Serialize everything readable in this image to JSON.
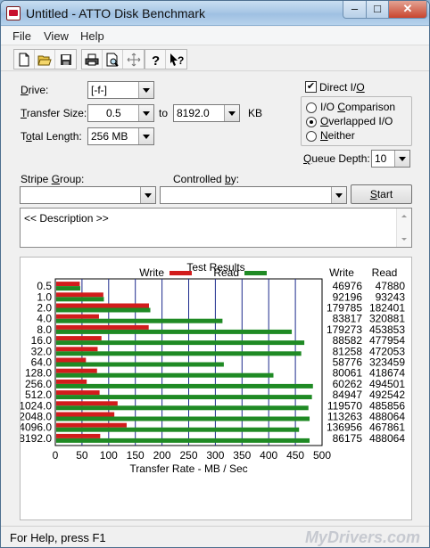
{
  "window": {
    "title": "Untitled - ATTO Disk Benchmark"
  },
  "caption": {
    "minimize": "–",
    "maximize": "□",
    "close": "✕"
  },
  "menu": [
    "File",
    "View",
    "Help"
  ],
  "toolbar": {
    "icons": [
      "new-icon",
      "open-icon",
      "save-icon",
      "print-icon",
      "print-preview-icon",
      "move-icon",
      "help-icon",
      "context-help-icon"
    ]
  },
  "form": {
    "drive_label": "Drive:",
    "drive_value": "[-f-]",
    "transfer_label": "Transfer Size:",
    "transfer_from": "0.5",
    "transfer_to_label": "to",
    "transfer_to": "8192.0",
    "transfer_unit": "KB",
    "length_label": "Total Length:",
    "length_value": "256 MB",
    "direct_io_label": "Direct I/O",
    "direct_io_checked": true,
    "io_options": [
      {
        "label": "I/O Comparison",
        "selected": false
      },
      {
        "label": "Overlapped I/O",
        "selected": true
      },
      {
        "label": "Neither",
        "selected": false
      }
    ],
    "queue_label": "Queue Depth:",
    "queue_value": "10",
    "stripe_label": "Stripe Group:",
    "stripe_value": "",
    "controlled_label": "Controlled by:",
    "controlled_value": "",
    "start_label": "Start",
    "description": "<< Description >>"
  },
  "results": {
    "title": "Test Results",
    "write_legend": "Write",
    "read_legend": "Read",
    "col_write": "Write",
    "col_read": "Read"
  },
  "chart_data": {
    "type": "bar",
    "categories": [
      "0.5",
      "1.0",
      "2.0",
      "4.0",
      "8.0",
      "16.0",
      "32.0",
      "64.0",
      "128.0",
      "256.0",
      "512.0",
      "1024.0",
      "2048.0",
      "4096.0",
      "8192.0"
    ],
    "series": [
      {
        "name": "Write",
        "color": "#d21c1c",
        "values": [
          46976,
          92196,
          179785,
          83817,
          179273,
          88582,
          81258,
          58776,
          80061,
          60262,
          84947,
          119570,
          113263,
          136956,
          86175
        ]
      },
      {
        "name": "Read",
        "color": "#1f8a24",
        "values": [
          47880,
          93243,
          182401,
          320881,
          453853,
          477954,
          472053,
          323459,
          418674,
          494501,
          492542,
          485856,
          488064,
          467861,
          488064
        ]
      }
    ],
    "xlabel": "Transfer Rate - MB / Sec",
    "xticks": [
      "0",
      "50",
      "100",
      "150",
      "200",
      "250",
      "300",
      "350",
      "400",
      "450",
      "500"
    ],
    "xlim": [
      0,
      500
    ],
    "grid": true,
    "legend": "top"
  },
  "status": {
    "text": "For Help, press F1"
  },
  "watermark": "MyDrivers.com"
}
